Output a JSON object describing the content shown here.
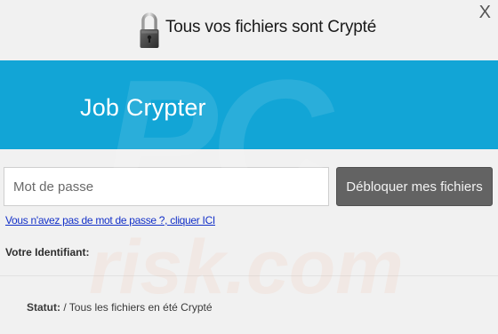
{
  "window": {
    "title": "Tous vos fichiers sont Crypté",
    "close_label": "X"
  },
  "banner": {
    "title": "Job Crypter"
  },
  "form": {
    "password_placeholder": "Mot de passe",
    "password_value": "",
    "unlock_button": "Débloquer mes fichiers",
    "no_password_link": "Vous n'avez pas de mot de passe ?, cliquer ICI",
    "identifier_label": "Votre Identifiant:"
  },
  "status": {
    "label": "Statut:",
    "text": " / Tous les fichiers en été Crypté"
  },
  "watermark": {
    "line1": "PC",
    "line2": "risk.com"
  },
  "colors": {
    "banner": "#12a5d6",
    "button": "#636363",
    "link": "#1330c8"
  },
  "icons": {
    "title_icon": "padlock-icon"
  }
}
